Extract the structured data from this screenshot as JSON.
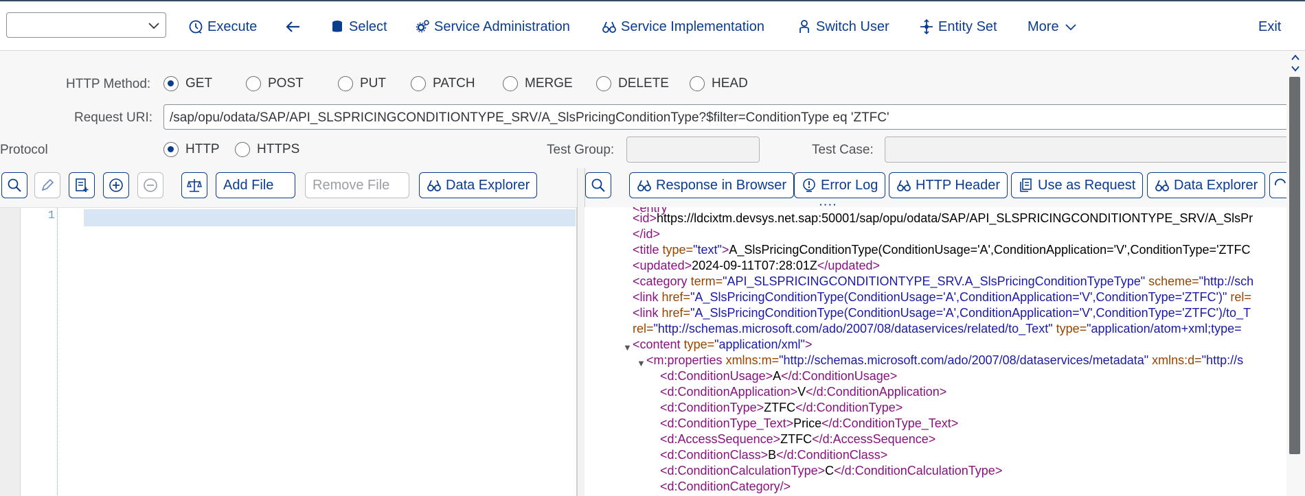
{
  "toolbar": {
    "dropdown_value": "",
    "execute": "Execute",
    "select": "Select",
    "service_administration": "Service Administration",
    "service_implementation": "Service Implementation",
    "switch_user": "Switch User",
    "entity_set": "Entity Set",
    "more": "More",
    "exit": "Exit"
  },
  "request": {
    "http_method_label": "HTTP Method:",
    "methods": [
      "GET",
      "POST",
      "PUT",
      "PATCH",
      "MERGE",
      "DELETE",
      "HEAD"
    ],
    "selected_method": "GET",
    "uri_label": "Request URI:",
    "uri_value": "/sap/opu/odata/SAP/API_SLSPRICINGCONDITIONTYPE_SRV/A_SlsPricingConditionType?$filter=ConditionType eq 'ZTFC'",
    "protocol_label": "Protocol",
    "protocols": [
      "HTTP",
      "HTTPS"
    ],
    "selected_protocol": "HTTP",
    "test_group_label": "Test Group:",
    "test_group_value": "",
    "test_case_label": "Test Case:",
    "test_case_value": ""
  },
  "request_panel": {
    "add_file": "Add File",
    "remove_file": "Remove File",
    "data_explorer": "Data Explorer",
    "line_number": "1"
  },
  "response_panel": {
    "response_in_browser": "Response in Browser",
    "error_log": "Error Log",
    "http_header": "HTTP Header",
    "use_as_request": "Use as Request",
    "data_explorer": "Data Explorer",
    "lines": {
      "l0_tag": "<id>",
      "l0_text": "https://ldcixtm.devsys.net.sap:50001/sap/opu/odata/SAP/API_SLSPRICINGCONDITIONTYPE_SRV/A_SlsPr",
      "l1_tag": "</id>",
      "l2_open": "<title",
      "l2_attr": " type=",
      "l2_val": "\"text\"",
      "l2_close": ">",
      "l2_text": "A_SlsPricingConditionType(ConditionUsage='A',ConditionApplication='V',ConditionType='ZTFC",
      "l3_open": "<updated>",
      "l3_text": "2024-09-11T07:28:01Z",
      "l3_close": "</updated>",
      "l4_open": "<category",
      "l4_attr1": " term=",
      "l4_val1": "\"API_SLSPRICINGCONDITIONTYPE_SRV.A_SlsPricingConditionTypeType\"",
      "l4_attr2": " scheme=",
      "l4_val2": "\"http://sch",
      "l5_open": "<link",
      "l5_attr": " href=",
      "l5_val": "\"A_SlsPricingConditionType(ConditionUsage='A',ConditionApplication='V',ConditionType='ZTFC')\"",
      "l5_attr2": " rel=",
      "l6_open": "<link",
      "l6_attr": " href=",
      "l6_val": "\"A_SlsPricingConditionType(ConditionUsage='A',ConditionApplication='V',ConditionType='ZTFC')/to_T",
      "l7_attr": "rel=",
      "l7_val": "\"http://schemas.microsoft.com/ado/2007/08/dataservices/related/to_Text\"",
      "l7_attr2": " type=",
      "l7_val2": "\"application/atom+xml;type=",
      "l8_open": "<content",
      "l8_attr": " type=",
      "l8_val": "\"application/xml\"",
      "l8_close": ">",
      "l9_open": "<m:properties",
      "l9_attr": " xmlns:m=",
      "l9_val": "\"http://schemas.microsoft.com/ado/2007/08/dataservices/metadata\"",
      "l9_attr2": " xmlns:d=",
      "l9_val2": "\"http://s",
      "props": [
        {
          "open": "<d:ConditionUsage>",
          "text": "A",
          "close": "</d:ConditionUsage>"
        },
        {
          "open": "<d:ConditionApplication>",
          "text": "V",
          "close": "</d:ConditionApplication>"
        },
        {
          "open": "<d:ConditionType>",
          "text": "ZTFC",
          "close": "</d:ConditionType>"
        },
        {
          "open": "<d:ConditionType_Text>",
          "text": "Price",
          "close": "</d:ConditionType_Text>"
        },
        {
          "open": "<d:AccessSequence>",
          "text": "ZTFC",
          "close": "</d:AccessSequence>"
        },
        {
          "open": "<d:ConditionClass>",
          "text": "B",
          "close": "</d:ConditionClass>"
        },
        {
          "open": "<d:ConditionCalculationType>",
          "text": "C",
          "close": "</d:ConditionCalculationType>"
        },
        {
          "open": "<d:ConditionCategory/>",
          "text": "",
          "close": ""
        }
      ]
    }
  },
  "colors": {
    "accent": "#0a3d8f",
    "xml_tag": "#881280",
    "xml_attr": "#994500",
    "xml_value": "#1a1aa6"
  }
}
